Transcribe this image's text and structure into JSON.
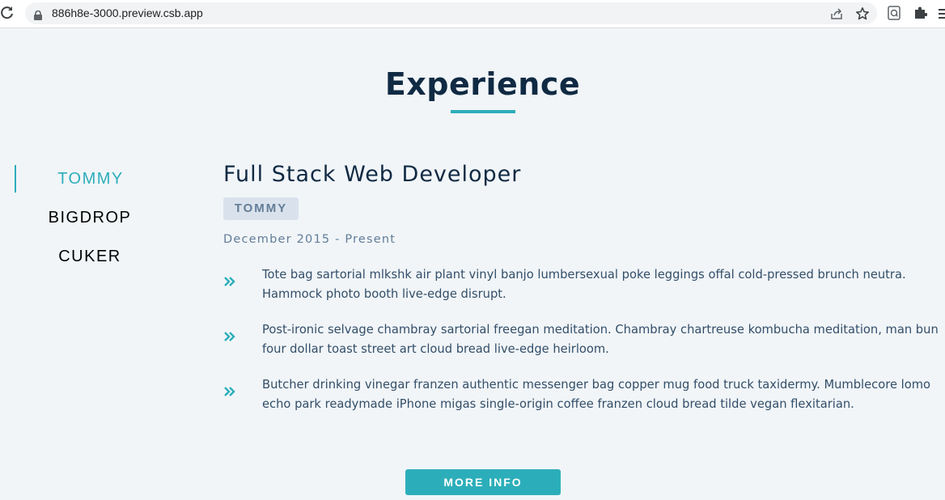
{
  "browser": {
    "url": "886h8e-3000.preview.csb.app",
    "icons": [
      "reload-icon",
      "lock-icon",
      "share-icon",
      "bookmark-star-icon",
      "extension-icon",
      "puzzle-icon",
      "menu-icon"
    ]
  },
  "section": {
    "title": "Experience",
    "accent_color": "#2caeba"
  },
  "tabs": [
    {
      "label": "TOMMY",
      "active": true
    },
    {
      "label": "BIGDROP",
      "active": false
    },
    {
      "label": "CUKER",
      "active": false
    }
  ],
  "job": {
    "title": "Full Stack Web Developer",
    "company": "TOMMY",
    "dates": "December 2015 - Present",
    "duties": [
      {
        "icon": "double-chevron-right-icon",
        "text": "Tote bag sartorial mlkshk air plant vinyl banjo lumbersexual poke leggings offal cold-pressed brunch neutra. Hammock photo booth live-edge disrupt."
      },
      {
        "icon": "double-chevron-right-icon",
        "text": "Post-ironic selvage chambray sartorial freegan meditation. Chambray chartreuse kombucha meditation, man bun four dollar toast street art cloud bread live-edge heirloom."
      },
      {
        "icon": "double-chevron-right-icon",
        "text": "Butcher drinking vinegar franzen authentic messenger bag copper mug food truck taxidermy. Mumblecore lomo echo park readymade iPhone migas single-origin coffee franzen cloud bread tilde vegan flexitarian."
      }
    ]
  },
  "more_button": {
    "label": "MORE INFO"
  }
}
